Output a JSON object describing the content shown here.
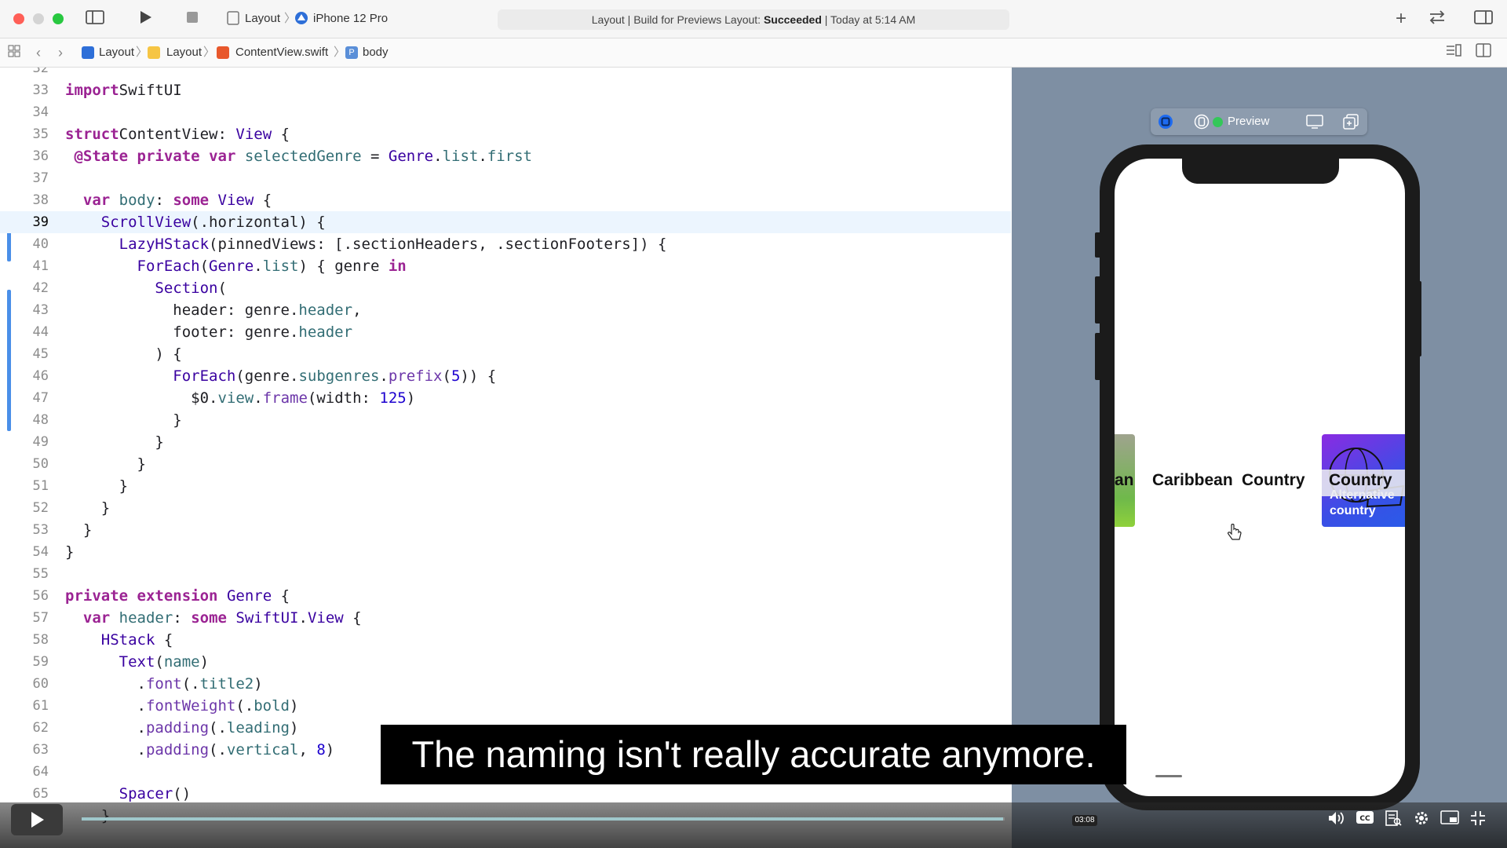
{
  "toolbar": {
    "scheme_name": "Layout",
    "device_name": "iPhone 12 Pro",
    "status_prefix": "Layout | Build for Previews Layout:",
    "status_result": "Succeeded",
    "status_suffix": "| Today at 5:14 AM",
    "icons": [
      "sidebar-toggle-icon",
      "play-icon",
      "stop-icon",
      "plus-icon",
      "swap-icon",
      "inspector-toggle-icon"
    ]
  },
  "breadcrumb": {
    "items": [
      "Layout",
      "Layout",
      "ContentView.swift",
      "body"
    ]
  },
  "editor": {
    "current_line": 39,
    "lines": [
      {
        "n": "32",
        "tokens": []
      },
      {
        "n": "33",
        "tokens": [
          [
            "kw",
            "import"
          ],
          [
            "",
            "SwiftUI"
          ]
        ]
      },
      {
        "n": "34",
        "tokens": []
      },
      {
        "n": "35",
        "tokens": [
          [
            "kw",
            "struct"
          ],
          [
            "",
            "ContentView"
          ],
          [
            "",
            ": "
          ],
          [
            "ty",
            "View"
          ],
          [
            "",
            " {"
          ]
        ]
      },
      {
        "n": "36",
        "tokens": [
          [
            "",
            " "
          ],
          [
            "kw",
            "@State"
          ],
          [
            "",
            " "
          ],
          [
            "kw",
            "private"
          ],
          [
            "",
            " "
          ],
          [
            "kw",
            "var"
          ],
          [
            "",
            " "
          ],
          [
            "pr",
            "selectedGenre"
          ],
          [
            "",
            " = "
          ],
          [
            "ty",
            "Genre"
          ],
          [
            "",
            "."
          ],
          [
            "pr",
            "list"
          ],
          [
            "",
            "."
          ],
          [
            "pr",
            "first"
          ]
        ]
      },
      {
        "n": "37",
        "tokens": []
      },
      {
        "n": "38",
        "tokens": [
          [
            "",
            "  "
          ],
          [
            "kw",
            "var"
          ],
          [
            "",
            " "
          ],
          [
            "pr",
            "body"
          ],
          [
            "",
            ": "
          ],
          [
            "kw",
            "some"
          ],
          [
            "",
            " "
          ],
          [
            "ty",
            "View"
          ],
          [
            "",
            " {"
          ]
        ]
      },
      {
        "n": "39",
        "tokens": [
          [
            "",
            "    "
          ],
          [
            "ty",
            "ScrollView"
          ],
          [
            "",
            "(.horizontal) {"
          ]
        ]
      },
      {
        "n": "40",
        "tokens": [
          [
            "",
            "      "
          ],
          [
            "ty",
            "LazyHStack"
          ],
          [
            "",
            "(pinnedViews: [.sectionHeaders, .sectionFooters]) {"
          ]
        ]
      },
      {
        "n": "41",
        "tokens": [
          [
            "",
            "        "
          ],
          [
            "ty",
            "ForEach"
          ],
          [
            "",
            "("
          ],
          [
            "ty",
            "Genre"
          ],
          [
            "",
            "."
          ],
          [
            "pr",
            "list"
          ],
          [
            "",
            ") { genre "
          ],
          [
            "kw",
            "in"
          ]
        ]
      },
      {
        "n": "42",
        "tokens": [
          [
            "",
            "          "
          ],
          [
            "ty",
            "Section"
          ],
          [
            "",
            "("
          ]
        ]
      },
      {
        "n": "43",
        "tokens": [
          [
            "",
            "            header: genre."
          ],
          [
            "pr",
            "header"
          ],
          [
            "",
            ","
          ]
        ]
      },
      {
        "n": "44",
        "tokens": [
          [
            "",
            "            footer: genre."
          ],
          [
            "pr",
            "header"
          ]
        ]
      },
      {
        "n": "45",
        "tokens": [
          [
            "",
            "          ) {"
          ]
        ]
      },
      {
        "n": "46",
        "tokens": [
          [
            "",
            "            "
          ],
          [
            "ty",
            "ForEach"
          ],
          [
            "",
            "(genre."
          ],
          [
            "pr",
            "subgenres"
          ],
          [
            "",
            "."
          ],
          [
            "fn",
            "prefix"
          ],
          [
            "",
            "("
          ],
          [
            "nm",
            "5"
          ],
          [
            "",
            "))"
          ],
          [
            "",
            " {"
          ]
        ]
      },
      {
        "n": "47",
        "tokens": [
          [
            "",
            "              $0."
          ],
          [
            "pr",
            "view"
          ],
          [
            "",
            "."
          ],
          [
            "fn",
            "frame"
          ],
          [
            "",
            "(width: "
          ],
          [
            "nm",
            "125"
          ],
          [
            "",
            ")"
          ]
        ]
      },
      {
        "n": "48",
        "tokens": [
          [
            "",
            "            }"
          ]
        ]
      },
      {
        "n": "49",
        "tokens": [
          [
            "",
            "          }"
          ]
        ]
      },
      {
        "n": "50",
        "tokens": [
          [
            "",
            "        }"
          ]
        ]
      },
      {
        "n": "51",
        "tokens": [
          [
            "",
            "      }"
          ]
        ]
      },
      {
        "n": "52",
        "tokens": [
          [
            "",
            "    }"
          ]
        ]
      },
      {
        "n": "53",
        "tokens": [
          [
            "",
            "  }"
          ]
        ]
      },
      {
        "n": "54",
        "tokens": [
          [
            "",
            "}"
          ]
        ]
      },
      {
        "n": "55",
        "tokens": []
      },
      {
        "n": "56",
        "tokens": [
          [
            "kw",
            "private"
          ],
          [
            "",
            " "
          ],
          [
            "kw",
            "extension"
          ],
          [
            "",
            " "
          ],
          [
            "ty",
            "Genre"
          ],
          [
            "",
            " {"
          ]
        ]
      },
      {
        "n": "57",
        "tokens": [
          [
            "",
            "  "
          ],
          [
            "kw",
            "var"
          ],
          [
            "",
            " "
          ],
          [
            "pr",
            "header"
          ],
          [
            "",
            ": "
          ],
          [
            "kw",
            "some"
          ],
          [
            "",
            " "
          ],
          [
            "ty",
            "SwiftUI"
          ],
          [
            "",
            "."
          ],
          [
            "ty",
            "View"
          ],
          [
            "",
            " {"
          ]
        ]
      },
      {
        "n": "58",
        "tokens": [
          [
            "",
            "    "
          ],
          [
            "ty",
            "HStack"
          ],
          [
            "",
            " {"
          ]
        ]
      },
      {
        "n": "59",
        "tokens": [
          [
            "",
            "      "
          ],
          [
            "ty",
            "Text"
          ],
          [
            "",
            "("
          ],
          [
            "pr",
            "name"
          ],
          [
            "",
            ")"
          ]
        ]
      },
      {
        "n": "60",
        "tokens": [
          [
            "",
            "        ."
          ],
          [
            "fn",
            "font"
          ],
          [
            "",
            "(."
          ],
          [
            "pr",
            "title2"
          ],
          [
            "",
            ")"
          ]
        ]
      },
      {
        "n": "61",
        "tokens": [
          [
            "",
            "        ."
          ],
          [
            "fn",
            "fontWeight"
          ],
          [
            "",
            "(."
          ],
          [
            "pr",
            "bold"
          ],
          [
            "",
            ")"
          ]
        ]
      },
      {
        "n": "62",
        "tokens": [
          [
            "",
            "        ."
          ],
          [
            "fn",
            "padding"
          ],
          [
            "",
            "(."
          ],
          [
            "pr",
            "leading"
          ],
          [
            "",
            ")"
          ]
        ]
      },
      {
        "n": "63",
        "tokens": [
          [
            "",
            "        ."
          ],
          [
            "fn",
            "padding"
          ],
          [
            "",
            "(."
          ],
          [
            "pr",
            "vertical"
          ],
          [
            "",
            ", "
          ],
          [
            "nm",
            "8"
          ],
          [
            "",
            ")"
          ]
        ]
      },
      {
        "n": "64",
        "tokens": []
      },
      {
        "n": "65",
        "tokens": [
          [
            "",
            "      "
          ],
          [
            "ty",
            "Spacer"
          ],
          [
            "",
            "()"
          ]
        ]
      },
      {
        "n": "66",
        "tokens": [
          [
            "",
            "    }"
          ]
        ]
      }
    ]
  },
  "preview": {
    "label": "Preview",
    "genre_left_partial": "an",
    "genre_1": "Caribbean",
    "genre_2": "Country",
    "genre_3": "Country",
    "tile_caption": "Alternative country"
  },
  "caption": {
    "text": "The naming isn't really accurate anymore."
  },
  "video": {
    "time": "03:08",
    "progress": 0.998
  }
}
